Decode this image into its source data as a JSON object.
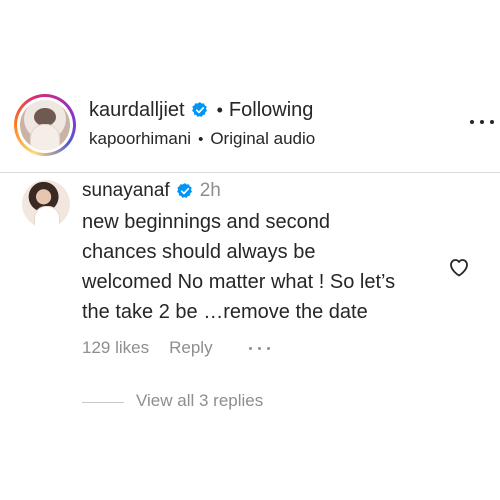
{
  "post_header": {
    "username": "kaurdalljiet",
    "separator": "•",
    "following_label": "Following",
    "audio_user": "kapoorhimani",
    "audio_separator": "•",
    "audio_label": "Original audio"
  },
  "comment": {
    "username": "sunayanaf",
    "time": "2h",
    "lines": [
      "new beginnings and second",
      "chances should always be",
      "welcomed No matter what ! So let’s",
      "the take 2 be …remove the date"
    ],
    "likes": "129 likes",
    "reply_label": "Reply"
  },
  "replies": {
    "view_label": "View all 3 replies"
  },
  "colors": {
    "text": "#262626",
    "secondary": "#8e8e8e",
    "verified": "#0095f6"
  },
  "icons": {
    "verified": "verified-badge-icon",
    "more": "more-horizontal-icon",
    "like": "heart-outline-icon"
  }
}
